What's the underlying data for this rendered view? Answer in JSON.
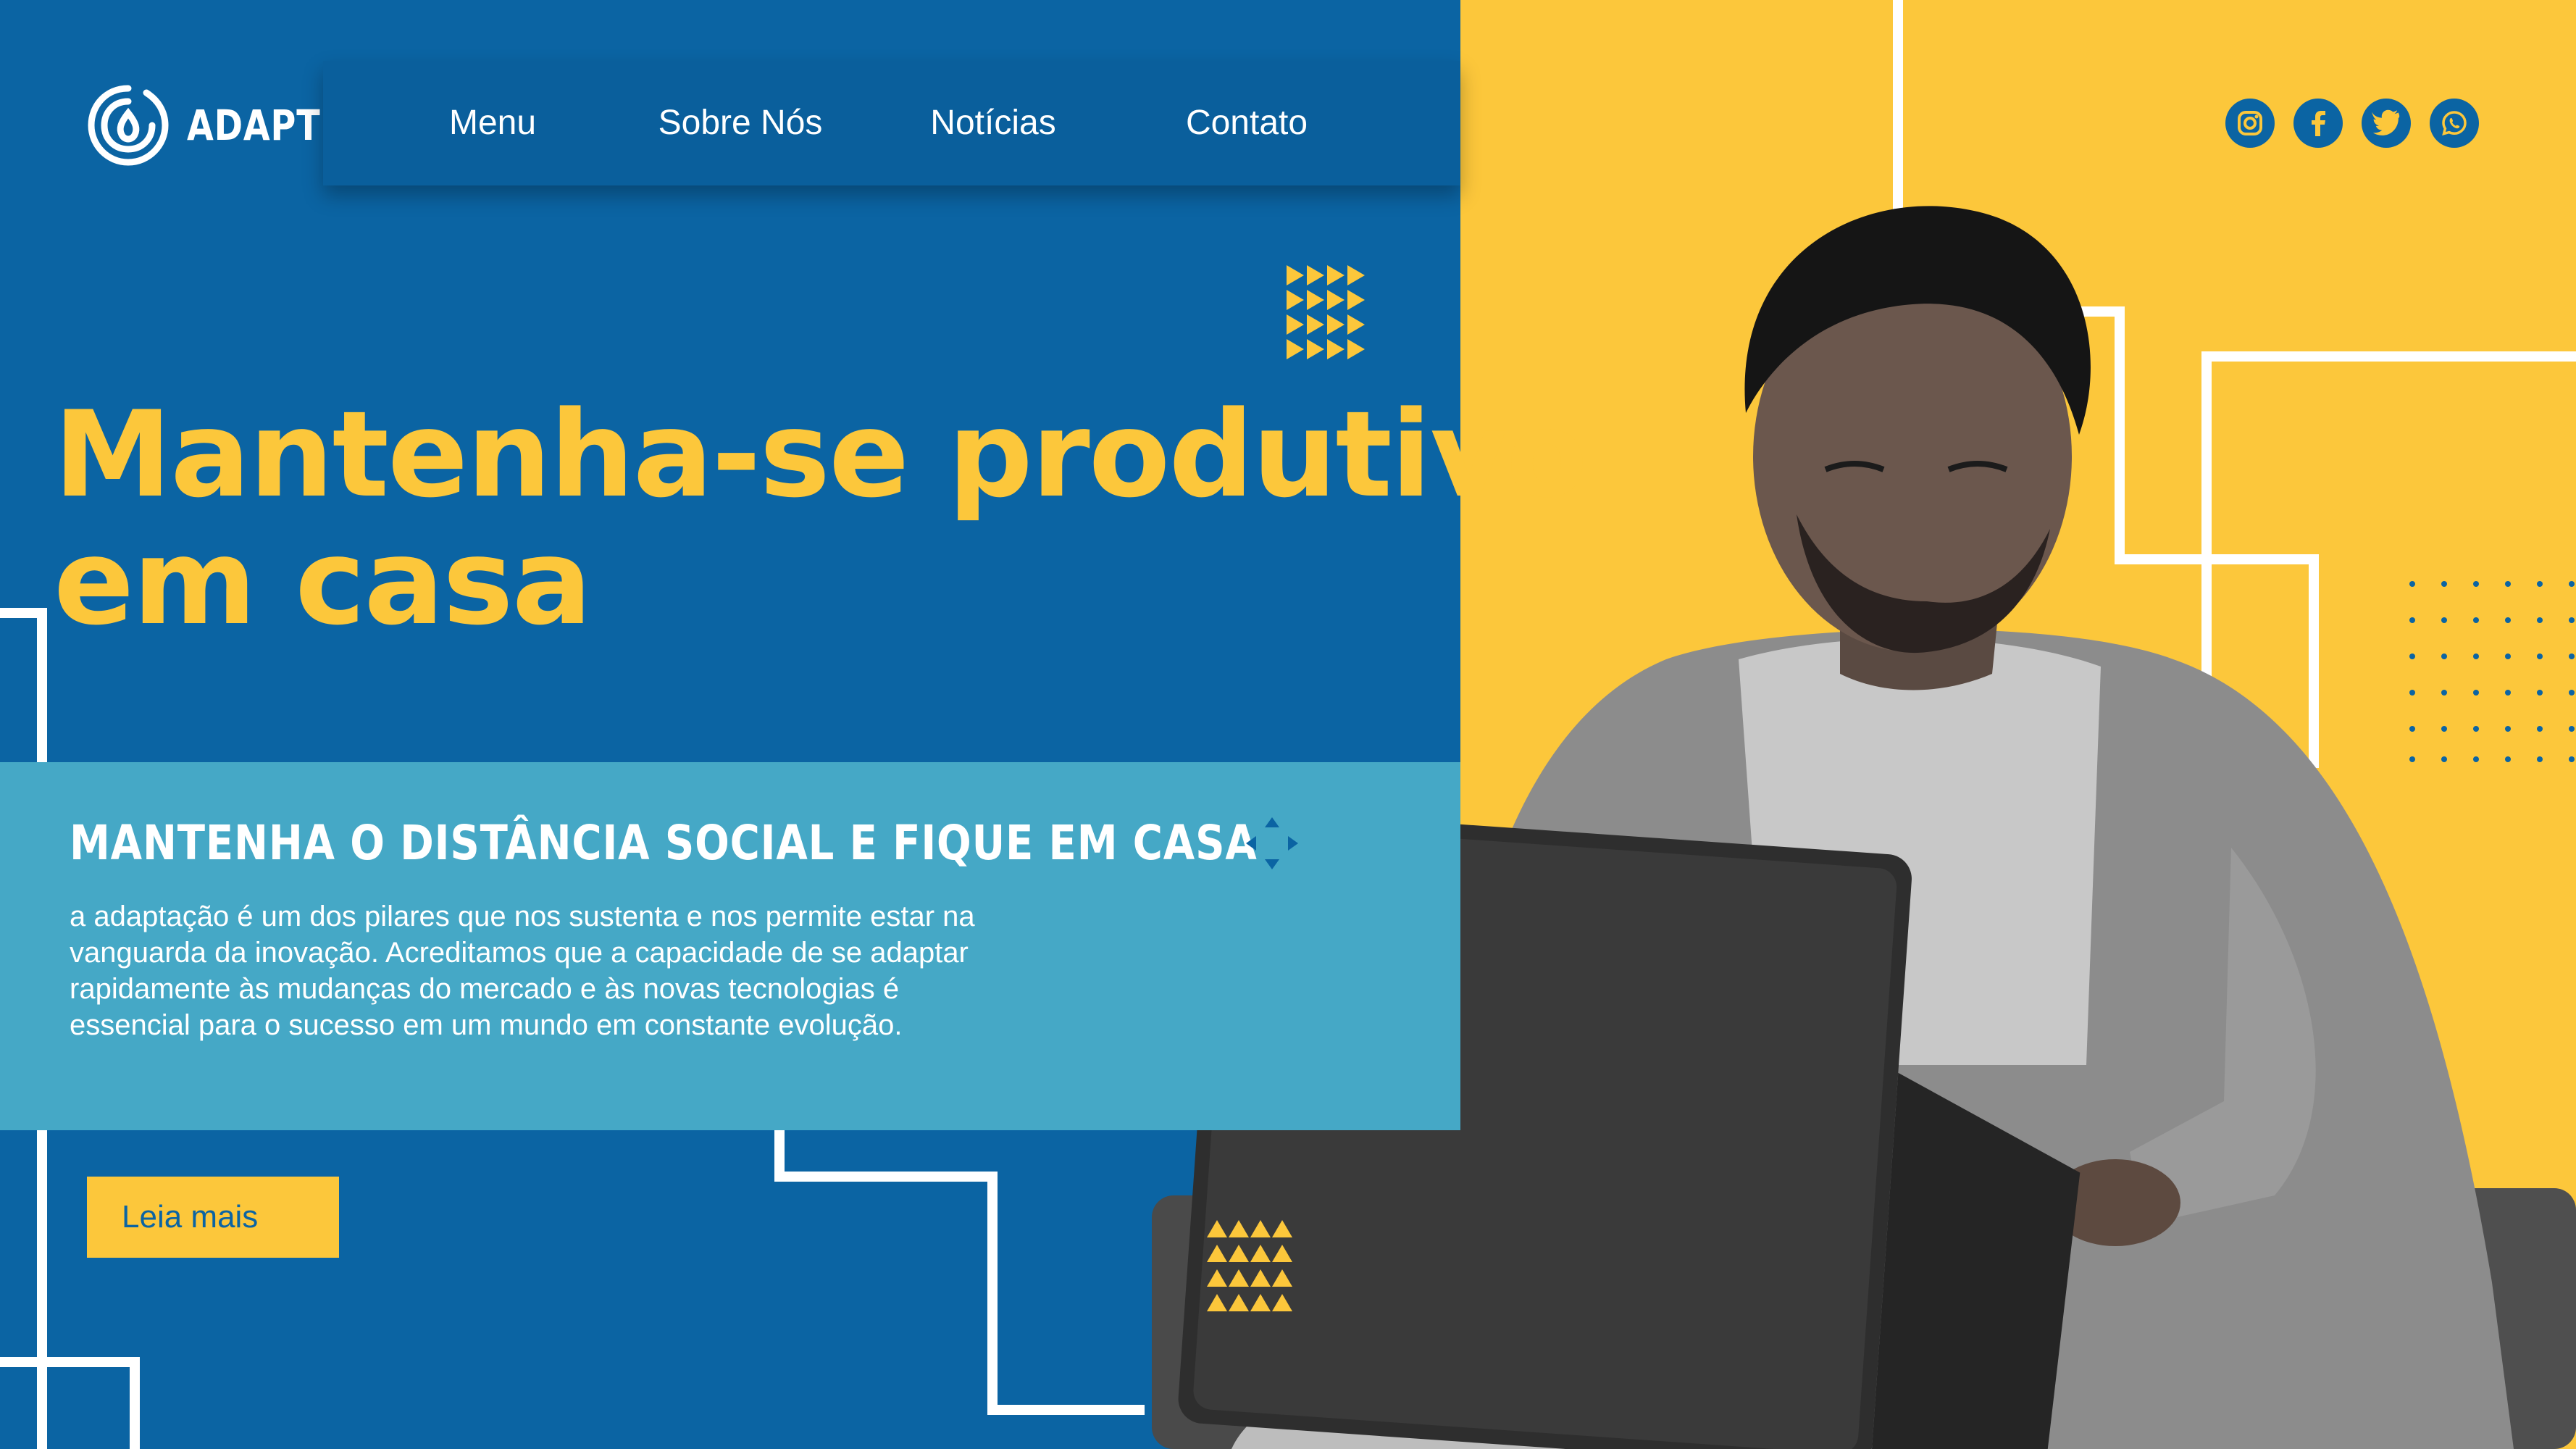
{
  "brand": {
    "name": "ADAPT",
    "logo_icon": "water-drop-logo-icon"
  },
  "nav": {
    "items": [
      {
        "label": "Menu"
      },
      {
        "label": "Sobre Nós"
      },
      {
        "label": "Notícias"
      },
      {
        "label": "Contato"
      }
    ]
  },
  "socials": [
    {
      "icon": "instagram-icon"
    },
    {
      "icon": "facebook-icon"
    },
    {
      "icon": "twitter-icon"
    },
    {
      "icon": "whatsapp-icon"
    }
  ],
  "hero": {
    "headline_line1": "Mantenha-se produtivo",
    "headline_line2": "em casa"
  },
  "info": {
    "title": "MANTENHA O DISTÂNCIA SOCIAL E FIQUE EM CASA",
    "body": "a adaptação é um dos pilares que nos sustenta e nos permite estar na vanguarda da inovação. Acreditamos que a capacidade de se adaptar rapidamente às mudanças do mercado e às novas tecnologias é essencial para o sucesso em um mundo em constante evolução."
  },
  "cta": {
    "label": "Leia mais"
  },
  "colors": {
    "blue": "#0b64a3",
    "navy": "#0a5f9c",
    "yellow": "#fcc73b",
    "light_blue": "#45a8c6",
    "white": "#ffffff"
  }
}
